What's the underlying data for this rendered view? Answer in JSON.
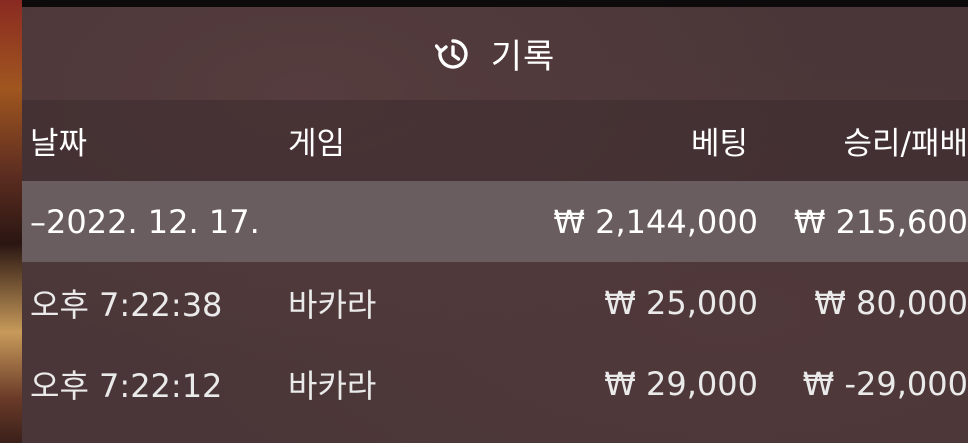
{
  "title": {
    "text": "기록",
    "icon": "history-icon"
  },
  "columns": {
    "date": "날짜",
    "game": "게임",
    "bet": "베팅",
    "win_lose": "승리/패배"
  },
  "date_group": {
    "date": "–2022. 12. 17.",
    "bet_total": "₩ 2,144,000",
    "win_total": "₩ 215,600"
  },
  "rows": [
    {
      "time": "오후 7:22:38",
      "game": "바카라",
      "bet": "₩ 25,000",
      "result": "₩ 80,000"
    },
    {
      "time": "오후 7:22:12",
      "game": "바카라",
      "bet": "₩ 29,000",
      "result": "₩ -29,000"
    }
  ],
  "colors": {
    "panel": "#4a3638",
    "date_row": "#6a5d5f",
    "text": "#ffffff"
  }
}
